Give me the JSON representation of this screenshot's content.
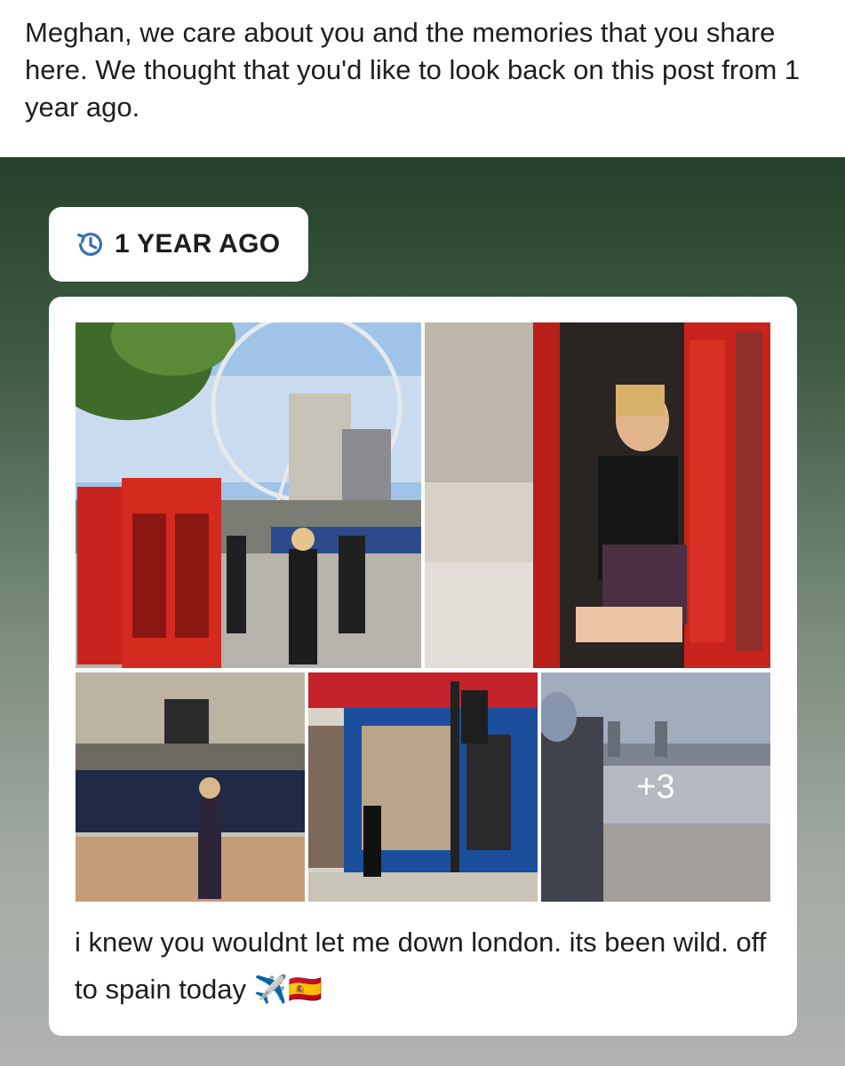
{
  "intro": {
    "text": "Meghan, we care about you and the memories that you share here. We thought that you'd like to look back on this post from 1 year ago."
  },
  "memory": {
    "badge_icon": "history-clock-icon",
    "badge_label": "1 YEAR AGO"
  },
  "post": {
    "photos": [
      {
        "name": "london-eye-phone-boxes-photo"
      },
      {
        "name": "red-phone-booth-photo"
      },
      {
        "name": "buckingham-palace-photo"
      },
      {
        "name": "kebab-shop-photo"
      },
      {
        "name": "tower-bridge-photo"
      }
    ],
    "more_photos_label": "+3",
    "caption": "i knew you wouldnt let me down london. its been wild. off to spain today ✈️🇪🇸"
  },
  "colors": {
    "panel_top": "#23412a",
    "panel_bottom": "#b0b2b0",
    "badge_icon": "#3b6fb6",
    "phone_box_red": "#c8231c"
  }
}
